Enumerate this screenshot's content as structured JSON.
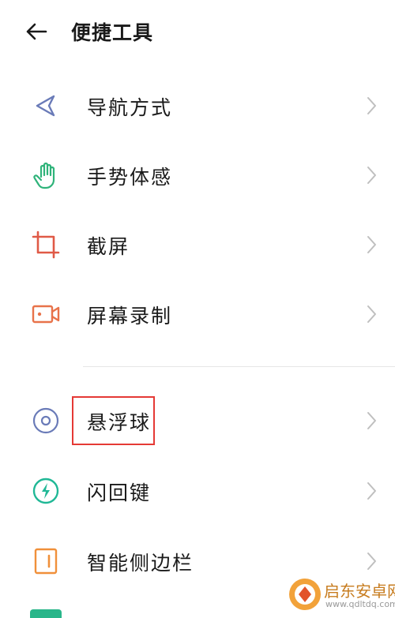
{
  "header": {
    "title": "便捷工具"
  },
  "items": [
    {
      "label": "导航方式",
      "icon": "navigation-icon",
      "color": "#6a7bb8"
    },
    {
      "label": "手势体感",
      "icon": "hand-gesture-icon",
      "color": "#2fb37a"
    },
    {
      "label": "截屏",
      "icon": "crop-icon",
      "color": "#e05a47"
    },
    {
      "label": "屏幕录制",
      "icon": "screen-record-icon",
      "color": "#e8734a"
    },
    {
      "label": "悬浮球",
      "icon": "floating-ball-icon",
      "color": "#6a7bb8",
      "highlighted": true
    },
    {
      "label": "闪回键",
      "icon": "flash-key-icon",
      "color": "#20b896"
    },
    {
      "label": "智能侧边栏",
      "icon": "smart-sidebar-icon",
      "color": "#f0903a"
    }
  ],
  "watermark": {
    "cn": "启东安卓网",
    "en": "www.qdltdq.com"
  },
  "colors": {
    "highlight_border": "#e53935",
    "chevron": "#bfbfbf"
  }
}
